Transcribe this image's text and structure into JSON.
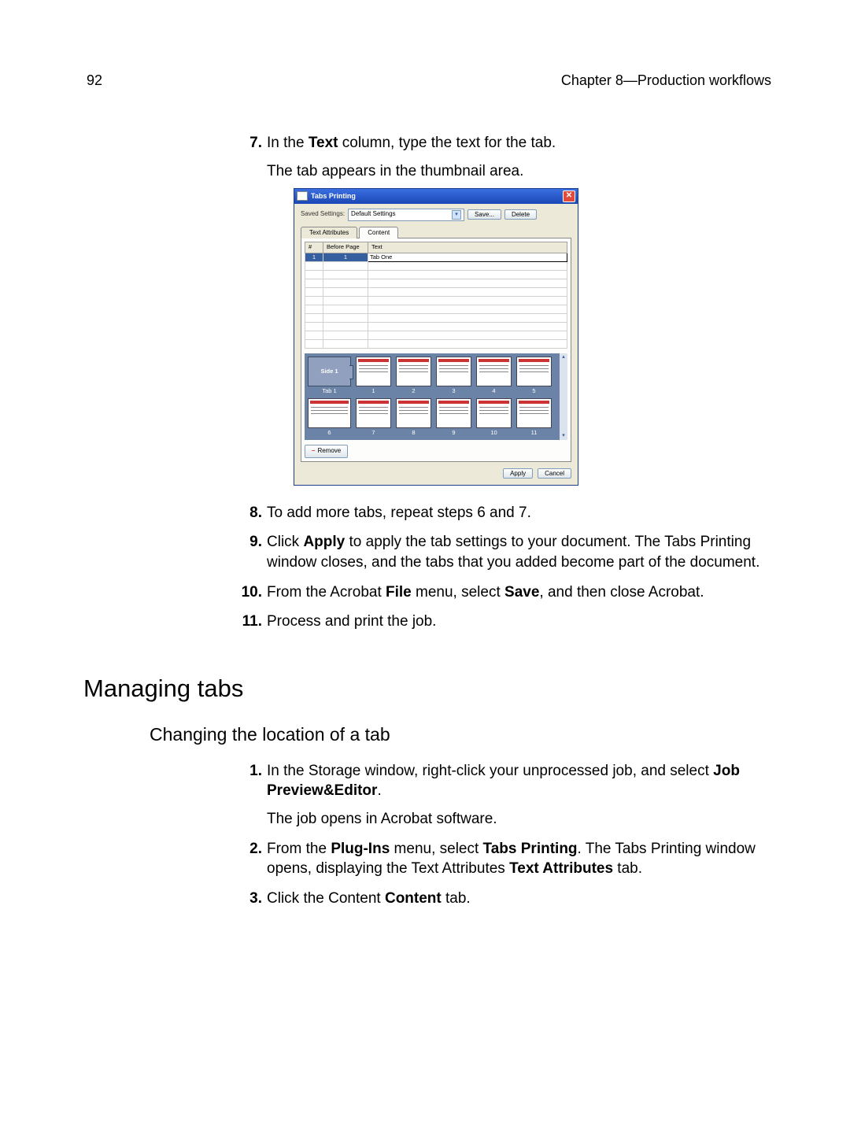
{
  "header": {
    "page_number": "92",
    "chapter": "Chapter 8—Production workflows"
  },
  "steps_a": [
    {
      "num": "7.",
      "html": "In the {b}Text{/b} column, type the text for the tab.",
      "para2": "The tab appears in the thumbnail area."
    },
    {
      "num": "8.",
      "html": "To add more tabs, repeat steps 6 and 7."
    },
    {
      "num": "9.",
      "html": "Click {b}Apply{/b} to apply the tab settings to your document. The Tabs Printing window closes, and the tabs that you added become part of the document."
    },
    {
      "num": "10.",
      "html": "From the Acrobat {b}File{/b} menu, select {b}Save{/b}, and then close Acrobat."
    },
    {
      "num": "11.",
      "html": "Process and print the job."
    }
  ],
  "section_heading": "Managing tabs",
  "subsection_heading": "Changing the location of a tab",
  "steps_b": [
    {
      "num": "1.",
      "html": "In the Storage window, right-click your unprocessed job, and select {b}Job Preview&Editor{/b}.",
      "para2": "The job opens in Acrobat software."
    },
    {
      "num": "2.",
      "html": "From the {b}Plug-Ins{/b} menu, select {b}Tabs Printing{/b}. The Tabs Printing window opens, displaying the Text Attributes {b}Text Attributes{/b} tab."
    },
    {
      "num": "3.",
      "html": "Click the Content {b}Content{/b} tab."
    }
  ],
  "dialog": {
    "title": "Tabs Printing",
    "saved_settings_label": "Saved Settings:",
    "saved_settings_value": "Default Settings",
    "save_btn": "Save...",
    "delete_btn": "Delete",
    "tab_text_attributes": "Text Attributes",
    "tab_content": "Content",
    "col_num": "#",
    "col_before": "Before Page",
    "col_text": "Text",
    "row_num": "1",
    "row_before": "1",
    "row_text": "Tab One",
    "side_slot": "Side 1",
    "tab1_caption": "Tab 1",
    "page_captions": [
      "1",
      "2",
      "3",
      "4",
      "5",
      "6",
      "7",
      "8",
      "9",
      "10",
      "11"
    ],
    "remove_btn": "Remove",
    "apply_btn": "Apply",
    "cancel_btn": "Cancel"
  }
}
